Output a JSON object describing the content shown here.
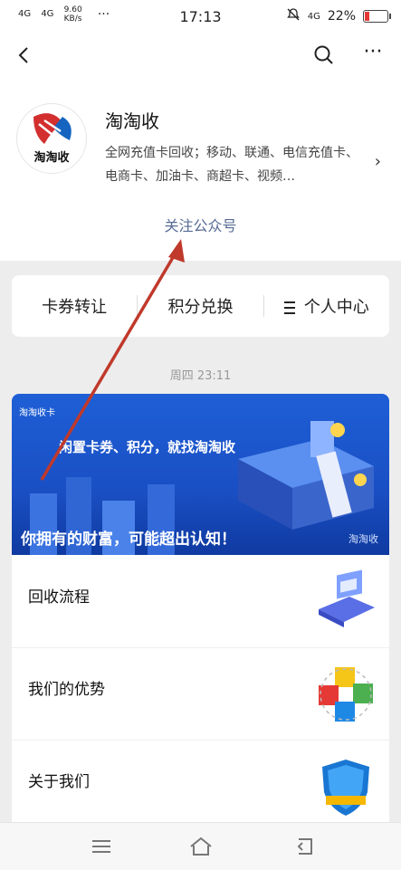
{
  "status_bar": {
    "signal1": "4G",
    "signal2": "4G",
    "speed": "9.60 KB/s",
    "dots": "···",
    "time": "17:13",
    "network": "4G",
    "battery": "22%",
    "battery_level": 0.22
  },
  "navbar": {
    "more": "···"
  },
  "account": {
    "logo_text": "淘淘收",
    "name": "淘淘收",
    "description": "全网充值卡回收；移动、联通、电信充值卡、电商卡、加油卡、商超卡、视频…",
    "follow_label": "关注公众号"
  },
  "menu": {
    "items": [
      "卡券转让",
      "积分兑换",
      "个人中心"
    ]
  },
  "timestamp": "周四 23:11",
  "article": {
    "banner_brand": "淘淘收卡",
    "banner_slogan": "闲置卡券、积分，就找淘淘收",
    "title": "你拥有的财富，可能超出认知！",
    "watermark": "淘淘收",
    "items": [
      {
        "label": "回收流程",
        "icon": "recycle-process-illustration"
      },
      {
        "label": "我们的优势",
        "icon": "puzzle-pieces-illustration"
      },
      {
        "label": "关于我们",
        "icon": "shield-badge-illustration"
      }
    ]
  },
  "colors": {
    "link": "#576b95",
    "banner": "#1e5fd6",
    "annotation_arrow": "#c0392b",
    "background": "#ededed"
  }
}
